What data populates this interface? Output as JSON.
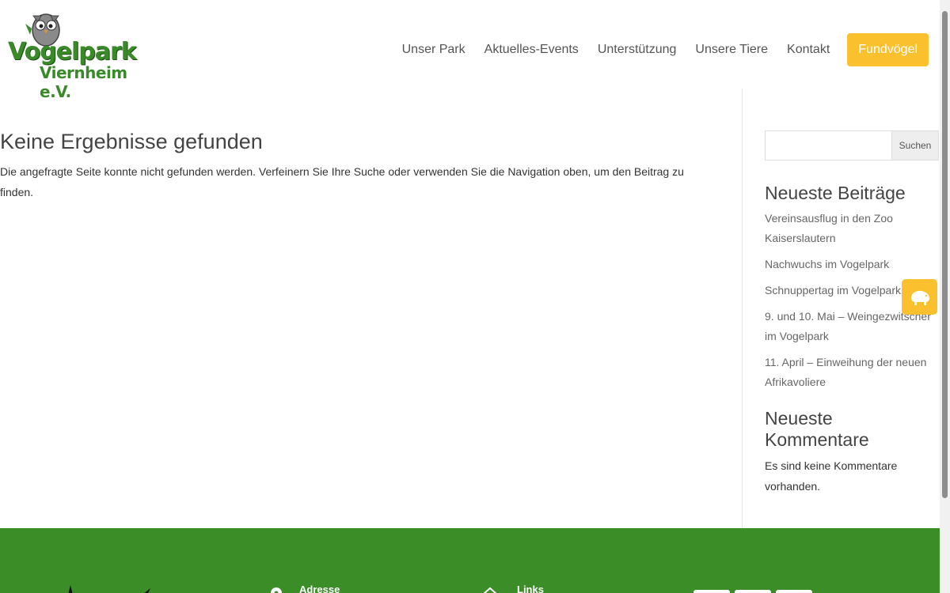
{
  "logo": {
    "title": "Vogelpark",
    "subtitle": "Viernheim e.V."
  },
  "nav": {
    "items": [
      "Unser Park",
      "Aktuelles-Events",
      "Unterstützung",
      "Unsere Tiere",
      "Kontakt"
    ],
    "cta": "Fundvögel"
  },
  "main": {
    "title": "Keine Ergebnisse gefunden",
    "text": "Die angefragte Seite konnte nicht gefunden werden. Verfeinern Sie Ihre Suche oder verwenden Sie die Navigation oben, um den Beitrag zu finden."
  },
  "sidebar": {
    "search_button": "Suchen",
    "search_value": "",
    "recent_posts_title": "Neueste Beiträge",
    "recent_posts": [
      "Vereinsausflug in den Zoo Kaiserslautern",
      "Nachwuchs im Vogelpark",
      "Schnuppertag im Vogelpark",
      "9. und 10. Mai – Weingezwitscher im Vogelpark",
      "11. April – Einweihung der neuen Afrikavoliere"
    ],
    "recent_comments_title": "Neueste Kommentare",
    "recent_comments_text": "Es sind keine Kommentare vorhanden."
  },
  "footer": {
    "address_heading": "Adresse",
    "links_heading": "Links"
  },
  "colors": {
    "brand_green": "#3a8d27",
    "accent_yellow": "#fbc02d"
  },
  "icons": {
    "float": "bird-icon",
    "address": "location-pin-icon",
    "links": "home-icon"
  }
}
